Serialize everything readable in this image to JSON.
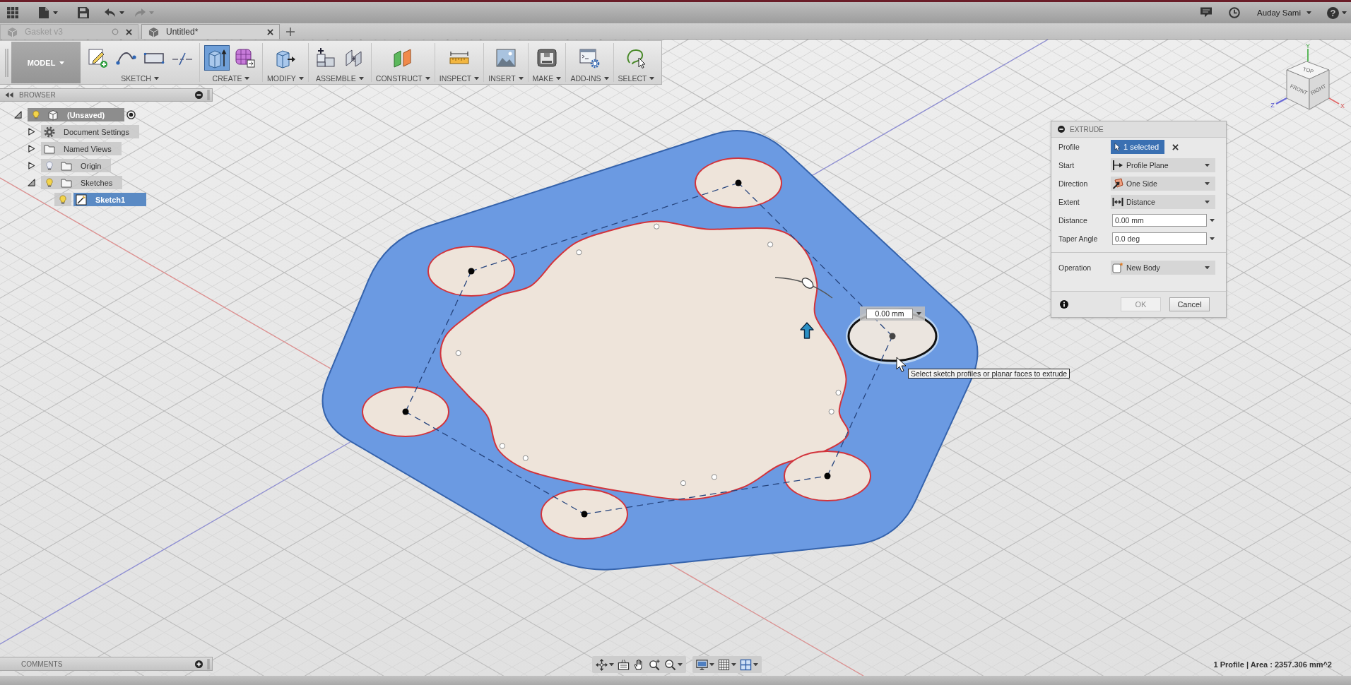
{
  "top_bar": {
    "undo": {
      "disabled": false
    },
    "redo": {
      "disabled": true
    },
    "user_name": "Auday Sami",
    "help": "?"
  },
  "document_tabs": [
    {
      "label": "Gasket v3",
      "selected": false
    },
    {
      "label": "Untitled*",
      "selected": true
    }
  ],
  "toolbar": {
    "workspace": "MODEL",
    "groups": [
      {
        "label": "SKETCH",
        "tools": [
          {
            "selected": false
          },
          {
            "selected": false
          },
          {
            "selected": false
          },
          {
            "selected": false
          }
        ]
      },
      {
        "label": "CREATE",
        "tools": [
          {
            "selected": true
          },
          {
            "selected": false
          }
        ]
      },
      {
        "label": "MODIFY",
        "tools": [
          {
            "selected": false
          }
        ]
      },
      {
        "label": "ASSEMBLE",
        "tools": [
          {
            "selected": false
          },
          {
            "selected": false
          }
        ]
      },
      {
        "label": "CONSTRUCT",
        "tools": [
          {
            "selected": false
          }
        ]
      },
      {
        "label": "INSPECT",
        "tools": [
          {
            "selected": false
          }
        ]
      },
      {
        "label": "INSERT",
        "tools": [
          {
            "selected": false
          }
        ]
      },
      {
        "label": "MAKE",
        "tools": [
          {
            "selected": false
          }
        ]
      },
      {
        "label": "ADD-INS",
        "tools": [
          {
            "selected": false
          }
        ]
      },
      {
        "label": "SELECT",
        "tools": [
          {
            "selected": false
          }
        ]
      }
    ]
  },
  "browser": {
    "title": "BROWSER",
    "tree": [
      {
        "label": "(Unsaved)",
        "kind": "component",
        "visible": true,
        "active": true,
        "expanded": true,
        "selected": false,
        "children": [
          {
            "label": "Document Settings",
            "kind": "settings",
            "expanded": false,
            "selected": false
          },
          {
            "label": "Named Views",
            "kind": "folder",
            "expanded": false,
            "selected": false
          },
          {
            "label": "Origin",
            "kind": "folder",
            "visible": false,
            "expanded": false,
            "selected": false
          },
          {
            "label": "Sketches",
            "kind": "folder",
            "visible": true,
            "expanded": true,
            "selected": false,
            "children": [
              {
                "label": "Sketch1",
                "kind": "sketch",
                "visible": true,
                "selected": true
              }
            ]
          }
        ]
      }
    ]
  },
  "extrude_dialog": {
    "title": "EXTRUDE",
    "rows": [
      {
        "label": "Profile",
        "kind": "selection",
        "value": "1 selected"
      },
      {
        "label": "Start",
        "kind": "dropdown",
        "value": "Profile Plane"
      },
      {
        "label": "Direction",
        "kind": "dropdown",
        "value": "One Side"
      },
      {
        "label": "Extent",
        "kind": "dropdown",
        "value": "Distance"
      },
      {
        "label": "Distance",
        "kind": "input",
        "value": "0.00 mm"
      },
      {
        "label": "Taper Angle",
        "kind": "input",
        "value": "0.0 deg"
      }
    ],
    "operation": {
      "label": "Operation",
      "value": "New Body"
    },
    "buttons": [
      {
        "label": "OK",
        "disabled": true
      },
      {
        "label": "Cancel",
        "disabled": false
      }
    ]
  },
  "canvas": {
    "distance_input": "0.00 mm",
    "tooltip": "Select sketch profiles or planar faces to extrude"
  },
  "view_cube": {
    "faces": [
      "TOP",
      "FRONT",
      "RIGHT"
    ],
    "axes": [
      "Y",
      "Z",
      "X"
    ]
  },
  "comments_panel": {
    "title": "COMMENTS"
  },
  "status_bar": {
    "text": "1 Profile | Area : 2357.306 mm^2"
  }
}
